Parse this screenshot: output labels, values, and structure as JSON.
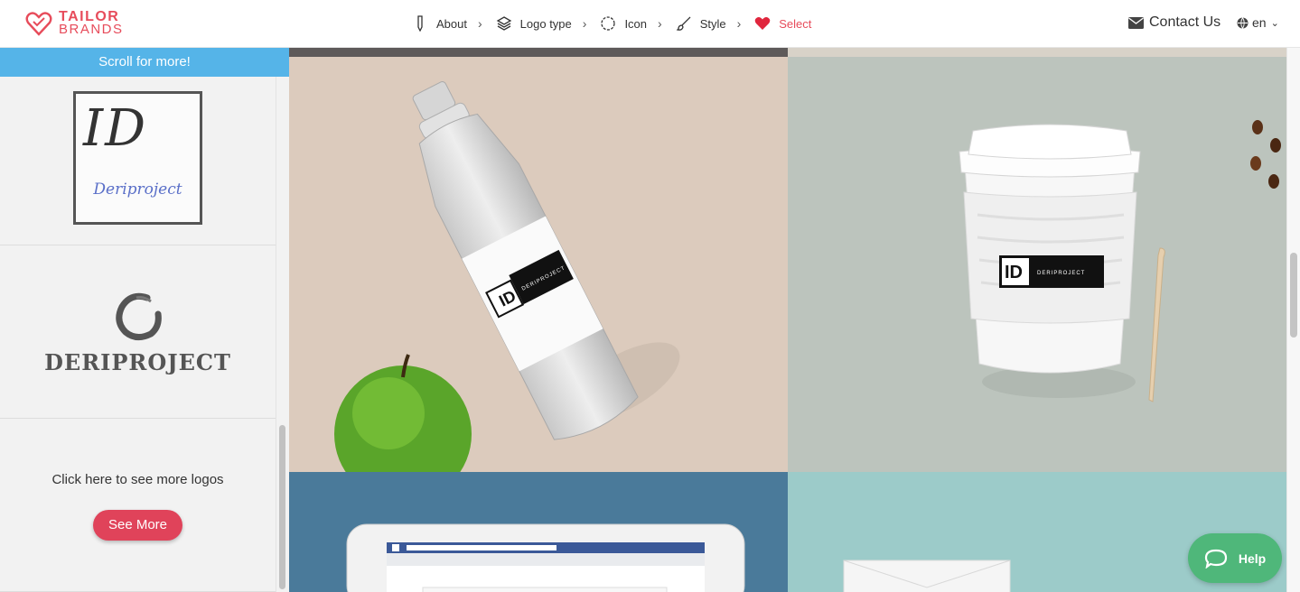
{
  "brand": {
    "line1": "TAILOR",
    "line2": "BRANDS",
    "color": "#e74c5b"
  },
  "steps": [
    {
      "label": "About",
      "icon": "pencil-icon"
    },
    {
      "label": "Logo type",
      "icon": "layers-icon"
    },
    {
      "label": "Icon",
      "icon": "circle-icon"
    },
    {
      "label": "Style",
      "icon": "brush-icon"
    },
    {
      "label": "Select",
      "icon": "heart-icon",
      "active": true
    }
  ],
  "header": {
    "contact_label": "Contact Us",
    "lang_label": "en"
  },
  "sidebar": {
    "banner": "Scroll for more!",
    "logo1": {
      "monogram": "ID",
      "name": "Deriproject"
    },
    "logo2": {
      "name": "DERIPROJECT"
    },
    "more": {
      "text": "Click here to see more logos",
      "button": "See More"
    }
  },
  "mockups": {
    "bottle_label": "DERIPROJECT",
    "cup_label": "DERIPROJECT"
  },
  "help": {
    "label": "Help"
  },
  "colors": {
    "accent": "#e74c5b",
    "banner": "#55b4e8",
    "help": "#4fb77a"
  }
}
